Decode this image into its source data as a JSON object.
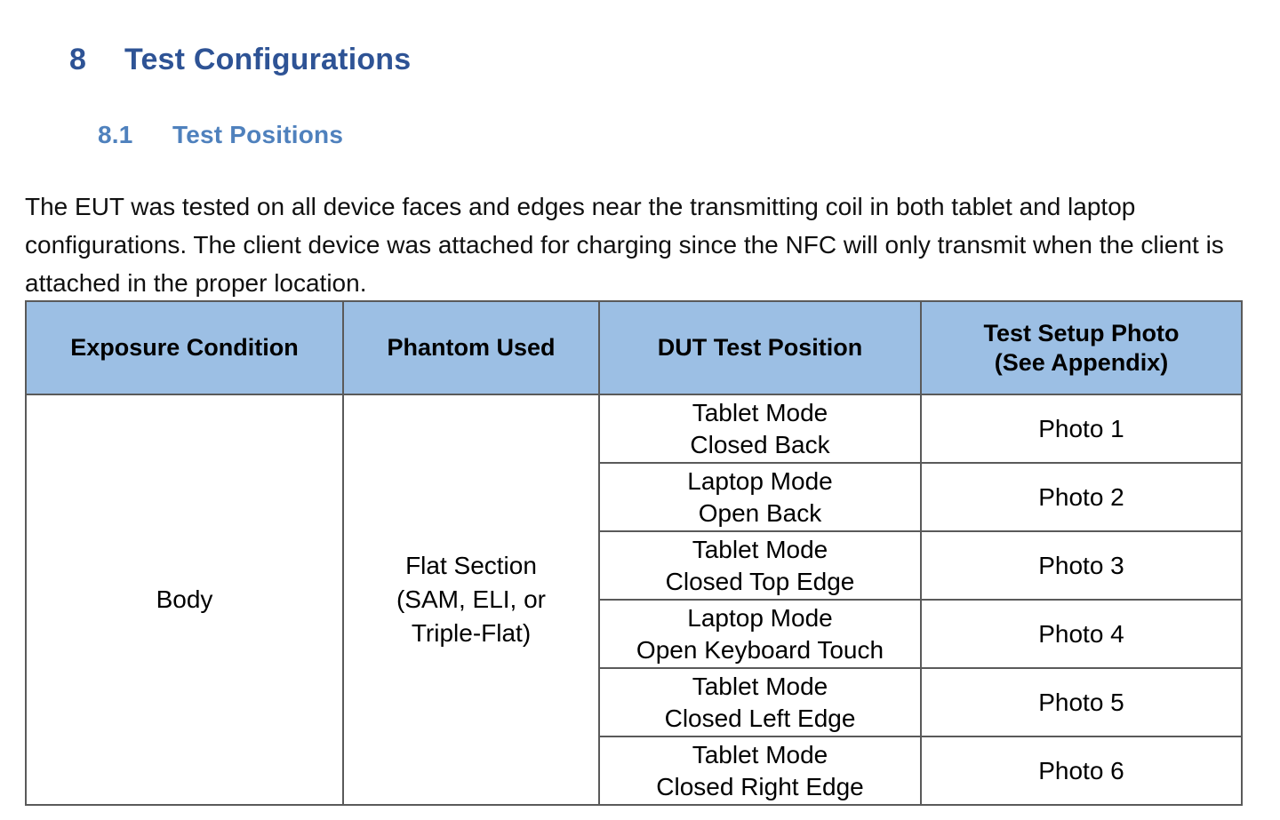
{
  "headings": {
    "h1_number": "8",
    "h1_text": "Test Configurations",
    "h2_number": "8.1",
    "h2_text": "Test Positions"
  },
  "paragraph": "The EUT was tested on all device faces and edges near the transmitting coil in both tablet and laptop configurations.  The client device was attached for charging since the NFC will only transmit when the client is attached in the proper location.",
  "table": {
    "columns": [
      {
        "label": "Exposure Condition"
      },
      {
        "label": "Phantom Used"
      },
      {
        "label": "DUT Test Position"
      },
      {
        "label_line1": "Test Setup Photo",
        "label_line2": "(See Appendix)"
      }
    ],
    "exposure_condition": "Body",
    "phantom_used": {
      "line1": "Flat Section",
      "line2": "(SAM, ELI, or",
      "line3": "Triple-Flat)"
    },
    "rows": [
      {
        "position_line1": "Tablet Mode",
        "position_line2": "Closed Back",
        "photo": "Photo 1"
      },
      {
        "position_line1": "Laptop Mode",
        "position_line2": "Open Back",
        "photo": "Photo 2"
      },
      {
        "position_line1": "Tablet Mode",
        "position_line2": "Closed Top Edge",
        "photo": "Photo 3"
      },
      {
        "position_line1": "Laptop Mode",
        "position_line2": "Open Keyboard Touch",
        "photo": "Photo 4"
      },
      {
        "position_line1": "Tablet Mode",
        "position_line2": "Closed Left Edge",
        "photo": "Photo 5"
      },
      {
        "position_line1": "Tablet Mode",
        "position_line2": "Closed Right Edge",
        "photo": "Photo 6"
      }
    ]
  },
  "colors": {
    "heading1": "#2E5395",
    "heading2": "#4F81BD",
    "table_header_bg": "#9CBFE4",
    "table_border": "#5A5A5A",
    "body_text": "#101010"
  }
}
